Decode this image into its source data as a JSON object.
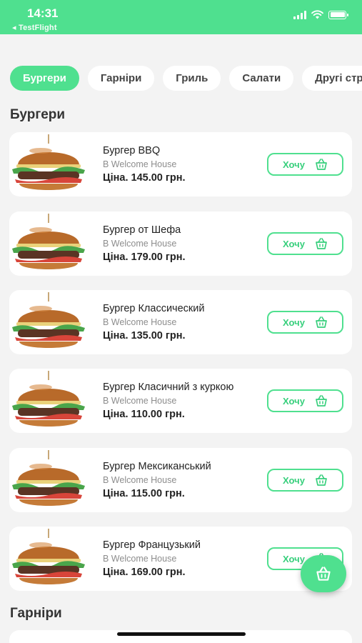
{
  "status_bar": {
    "time": "14:31",
    "back_app": "◂ TestFlight"
  },
  "tabs": [
    {
      "label": "Бургери",
      "active": true
    },
    {
      "label": "Гарніри",
      "active": false
    },
    {
      "label": "Гриль",
      "active": false
    },
    {
      "label": "Салати",
      "active": false
    },
    {
      "label": "Другі страви",
      "active": false
    }
  ],
  "sections": {
    "burgers_title": "Бургери",
    "sides_title": "Гарніри"
  },
  "products": [
    {
      "name": "Бургер BBQ",
      "place": "В Welcome House",
      "price": "Ціна. 145.00 грн.",
      "button": "Хочу"
    },
    {
      "name": "Бургер от Шефа",
      "place": "В Welcome House",
      "price": "Ціна. 179.00 грн.",
      "button": "Хочу"
    },
    {
      "name": "Бургер Классический",
      "place": "В Welcome House",
      "price": "Ціна. 135.00 грн.",
      "button": "Хочу"
    },
    {
      "name": "Бургер Класичний з куркою",
      "place": "В Welcome House",
      "price": "Ціна. 110.00 грн.",
      "button": "Хочу"
    },
    {
      "name": "Бургер Мексиканський",
      "place": "В Welcome House",
      "price": "Ціна. 115.00 грн.",
      "button": "Хочу"
    },
    {
      "name": "Бургер Французький",
      "place": "В Welcome House",
      "price": "Ціна. 169.00 грн.",
      "button": "Хочу"
    }
  ],
  "colors": {
    "accent": "#4fe08f",
    "accent_text": "#37cf7c",
    "background": "#f3f3f3"
  },
  "icons": {
    "cart": "basket-icon",
    "wifi": "wifi-icon",
    "signal": "signal-icon",
    "battery": "battery-icon"
  }
}
